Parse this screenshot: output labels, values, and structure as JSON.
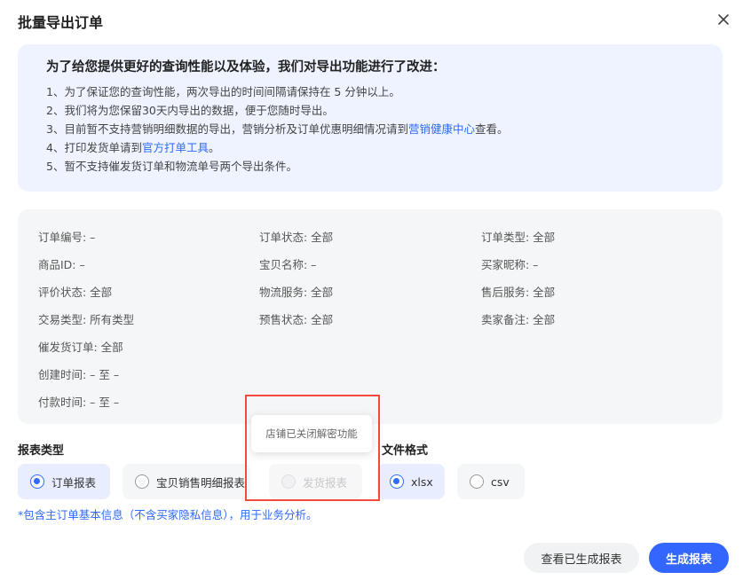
{
  "dialog": {
    "title": "批量导出订单",
    "close_icon": "close-icon"
  },
  "notice": {
    "title": "为了给您提供更好的查询性能以及体验，我们对导出功能进行了改进：",
    "lines": {
      "l1": "1、为了保证您的查询性能，两次导出的时间间隔请保持在 5 分钟以上。",
      "l2": "2、我们将为您保留30天内导出的数据，便于您随时导出。",
      "l3_pre": "3、目前暂不支持营销明细数据的导出，营销分析及订单优惠明细情况请到",
      "l3_link": "营销健康中心",
      "l3_post": "查看。",
      "l4_pre": "4、打印发货单请到",
      "l4_link": "官方打单工具",
      "l4_post": "。",
      "l5": "5、暂不支持催发货订单和物流单号两个导出条件。"
    }
  },
  "filters": {
    "order_no": "订单编号: –",
    "order_status": "订单状态: 全部",
    "order_type": "订单类型: 全部",
    "product_id": "商品ID: –",
    "item_name": "宝贝名称: –",
    "buyer_nick": "买家昵称: –",
    "review_status": "评价状态: 全部",
    "logistics": "物流服务: 全部",
    "after_sale": "售后服务: 全部",
    "trade_type": "交易类型: 所有类型",
    "presale": "预售状态: 全部",
    "seller_note": "卖家备注: 全部",
    "urge": "催发货订单: 全部",
    "created": "创建时间: – 至 –",
    "paid": "付款时间: – 至 –"
  },
  "report_type": {
    "label": "报表类型",
    "options": {
      "order": "订单报表",
      "item_sales": "宝贝销售明细报表",
      "shipping": "发货报表"
    },
    "selected": "订单报表",
    "hint": "*包含主订单基本信息（不含买家隐私信息），用于业务分析。"
  },
  "file_format": {
    "label": "文件格式",
    "options": {
      "xlsx": "xlsx",
      "csv": "csv"
    },
    "selected": "xlsx"
  },
  "tooltip": {
    "text": "店铺已关闭解密功能"
  },
  "buttons": {
    "view_generated": "查看已生成报表",
    "generate": "生成报表"
  },
  "colors": {
    "accent": "#3366ff",
    "notice_bg": "#eef3ff",
    "highlight": "#f4493c"
  }
}
